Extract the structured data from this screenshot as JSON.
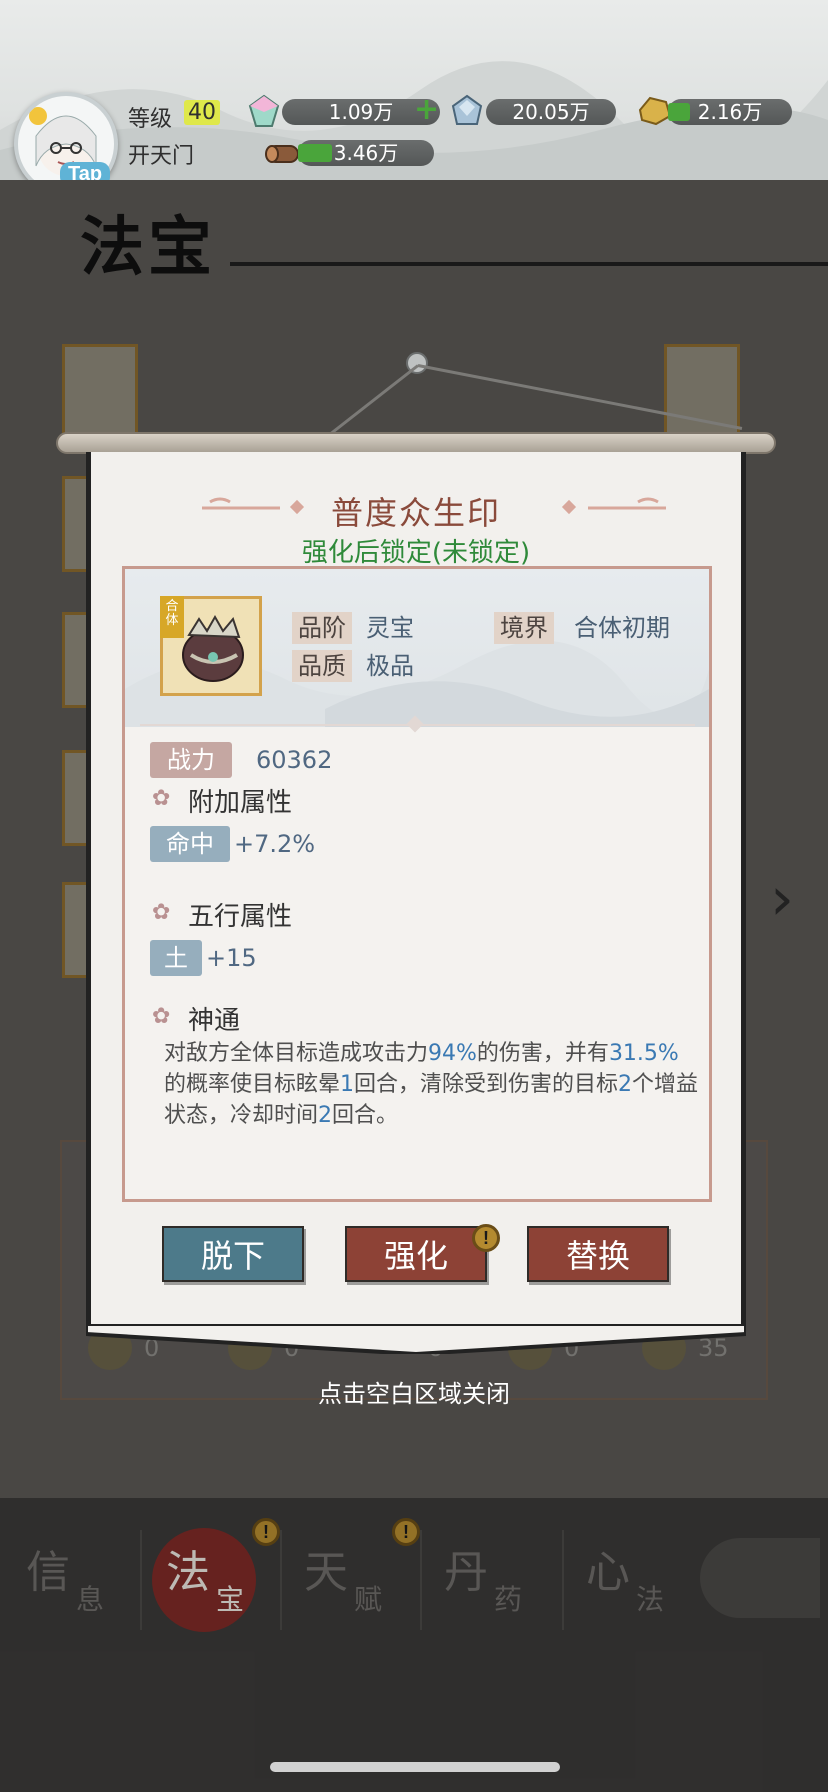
{
  "header": {
    "tap_badge": "Tap",
    "level_label": "等级",
    "level_value": "40",
    "realm": "开天门",
    "resources": [
      {
        "icon": "spirit-crystal-icon",
        "value": "1.09万"
      },
      {
        "icon": "ice-crystal-icon",
        "value": "20.05万"
      },
      {
        "icon": "gold-ore-icon",
        "value": "2.16万"
      },
      {
        "icon": "wood-log-icon",
        "value": "3.46万"
      }
    ]
  },
  "page": {
    "title": "法宝"
  },
  "modal": {
    "item_name": "普度众生印",
    "lock_status": "强化后锁定(未锁定)",
    "item_tag": "合体",
    "grade_label": "品阶",
    "grade_value": "灵宝",
    "realm_label": "境界",
    "realm_value": "合体初期",
    "quality_label": "品质",
    "quality_value": "极品",
    "power_label": "战力",
    "power_value": "60362",
    "extra_attr_title": "附加属性",
    "extra_attr_label": "命中",
    "extra_attr_value": "+7.2%",
    "five_elements_title": "五行属性",
    "element_label": "土",
    "element_value": "+15",
    "skill_title": "神通",
    "skill_desc": {
      "p1": "对敌方全体目标造成攻击力",
      "h1": "94%",
      "p2": "的伤害，并有",
      "h2": "31.5%",
      "p3": "的概率使目标眩晕",
      "h3": "1",
      "p4": "回合，清除受到伤害的目标",
      "h4": "2",
      "p5": "个增益状态，冷却时间",
      "h5": "2",
      "p6": "回合。"
    },
    "buttons": {
      "unequip": "脱下",
      "upgrade": "强化",
      "replace": "替换"
    },
    "close_hint": "点击空白区域关闭"
  },
  "background": {
    "element_counts": [
      "0",
      "0",
      "0",
      "0",
      "35"
    ]
  },
  "bottom_nav": [
    {
      "big": "信",
      "small": "息",
      "active": false
    },
    {
      "big": "法",
      "small": "宝",
      "active": true
    },
    {
      "big": "天",
      "small": "赋",
      "active": false
    },
    {
      "big": "丹",
      "small": "药",
      "active": false
    },
    {
      "big": "心",
      "small": "法",
      "active": false
    }
  ],
  "colors": {
    "accent_red": "#8d4236",
    "accent_blue": "#4d7a8a",
    "highlight_green": "#2f8a3a",
    "highlight_blue": "#3a79b3"
  }
}
